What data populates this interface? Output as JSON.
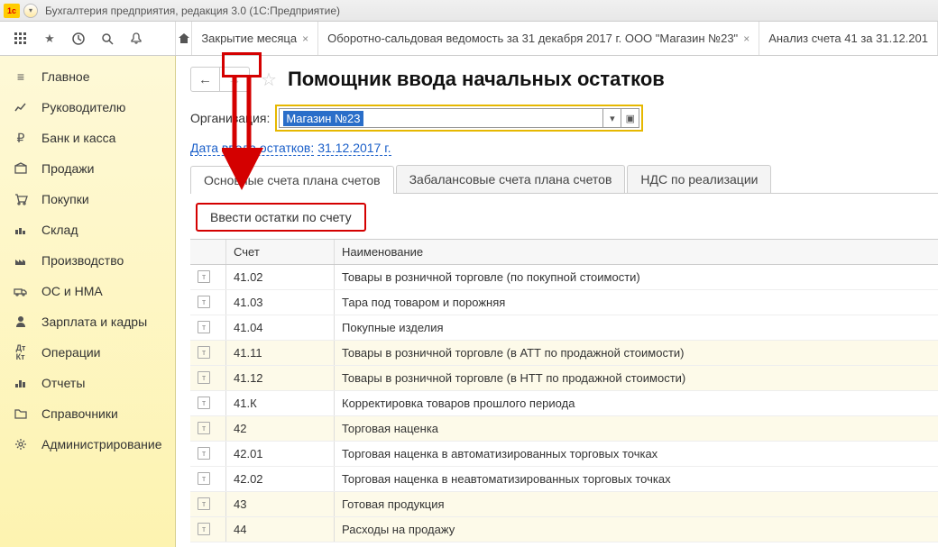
{
  "window": {
    "title": "Бухгалтерия предприятия, редакция 3.0  (1С:Предприятие)"
  },
  "tabs": {
    "t1": "Закрытие месяца",
    "t2": "Оборотно-сальдовая ведомость за 31 декабря 2017 г. ООО \"Магазин №23\"",
    "t3": "Анализ счета 41 за 31.12.201"
  },
  "sidebar": {
    "items": [
      {
        "label": "Главное"
      },
      {
        "label": "Руководителю"
      },
      {
        "label": "Банк и касса"
      },
      {
        "label": "Продажи"
      },
      {
        "label": "Покупки"
      },
      {
        "label": "Склад"
      },
      {
        "label": "Производство"
      },
      {
        "label": "ОС и НМА"
      },
      {
        "label": "Зарплата и кадры"
      },
      {
        "label": "Операции"
      },
      {
        "label": "Отчеты"
      },
      {
        "label": "Справочники"
      },
      {
        "label": "Администрирование"
      }
    ]
  },
  "page": {
    "title": "Помощник ввода начальных остатков",
    "org_label": "Организация:",
    "org_value": "Магазин №23",
    "date_label": "Дата ввода остатков:",
    "date_value": "31.12.2017 г."
  },
  "innerTabs": {
    "t1": "Основные счета плана счетов",
    "t2": "Забалансовые счета плана счетов",
    "t3": "НДС по реализации"
  },
  "action": {
    "enter_balances": "Ввести остатки по счету"
  },
  "grid": {
    "head": {
      "account": "Счет",
      "name": "Наименование"
    },
    "rows": [
      {
        "acc": "41.02",
        "name": "Товары в розничной торговле (по покупной стоимости)"
      },
      {
        "acc": "41.03",
        "name": "Тара под товаром и порожняя"
      },
      {
        "acc": "41.04",
        "name": "Покупные изделия"
      },
      {
        "acc": "41.11",
        "name": "Товары в розничной торговле (в АТТ по продажной стоимости)",
        "alt": true
      },
      {
        "acc": "41.12",
        "name": "Товары в розничной торговле (в НТТ по продажной стоимости)",
        "alt": true
      },
      {
        "acc": "41.К",
        "name": "Корректировка товаров прошлого периода"
      },
      {
        "acc": "42",
        "name": "Торговая наценка",
        "alt": true
      },
      {
        "acc": "42.01",
        "name": "Торговая наценка в автоматизированных торговых точках"
      },
      {
        "acc": "42.02",
        "name": "Торговая наценка в неавтоматизированных торговых точках"
      },
      {
        "acc": "43",
        "name": "Готовая продукция",
        "alt": true
      },
      {
        "acc": "44",
        "name": "Расходы на продажу",
        "alt": true
      }
    ]
  }
}
